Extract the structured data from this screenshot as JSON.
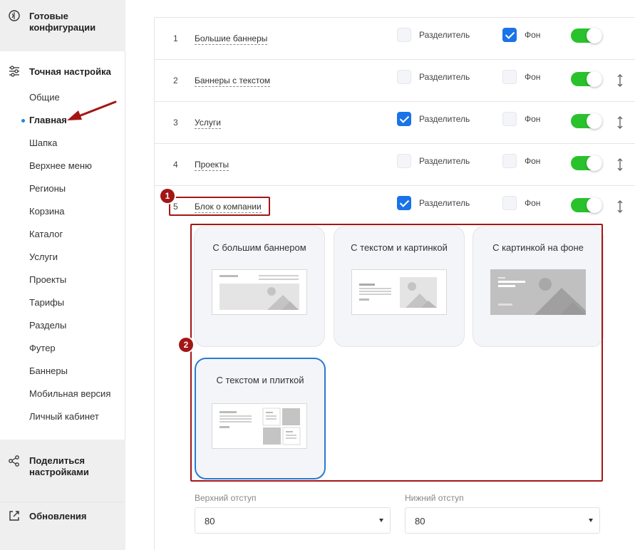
{
  "sidebar": {
    "ready_configs": "Готовые конфигурации",
    "fine_tuning": "Точная настройка",
    "items": [
      {
        "label": "Общие"
      },
      {
        "label": "Главная",
        "active": true
      },
      {
        "label": "Шапка"
      },
      {
        "label": "Верхнее меню"
      },
      {
        "label": "Регионы"
      },
      {
        "label": "Корзина"
      },
      {
        "label": "Каталог"
      },
      {
        "label": "Услуги"
      },
      {
        "label": "Проекты"
      },
      {
        "label": "Тарифы"
      },
      {
        "label": "Разделы"
      },
      {
        "label": "Футер"
      },
      {
        "label": "Баннеры"
      },
      {
        "label": "Мобильная версия"
      },
      {
        "label": "Личный кабинет"
      }
    ],
    "share": "Поделиться настройками",
    "updates": "Обновления"
  },
  "rows": [
    {
      "num": "1",
      "name": "Большие баннеры",
      "divider": false,
      "background": true,
      "enabled": true
    },
    {
      "num": "2",
      "name": "Баннеры с текстом",
      "divider": false,
      "background": false,
      "enabled": true
    },
    {
      "num": "3",
      "name": "Услуги",
      "divider": true,
      "background": false,
      "enabled": true
    },
    {
      "num": "4",
      "name": "Проекты",
      "divider": false,
      "background": false,
      "enabled": true
    },
    {
      "num": "5",
      "name": "Блок о компании",
      "divider": true,
      "background": false,
      "enabled": true
    }
  ],
  "labels": {
    "divider": "Разделитель",
    "background": "Фон"
  },
  "variants": [
    {
      "title": "С большим баннером",
      "selected": false
    },
    {
      "title": "С текстом и картинкой",
      "selected": false
    },
    {
      "title": "С картинкой на фоне",
      "selected": false
    },
    {
      "title": "С текстом и плиткой",
      "selected": true
    }
  ],
  "badges": {
    "one": "1",
    "two": "2"
  },
  "padding": {
    "top_label": "Верхний отступ",
    "top_value": "80",
    "bottom_label": "Нижний отступ",
    "bottom_value": "80"
  },
  "colors": {
    "accent": "#1a73e8",
    "toggle_on": "#29c22c",
    "annotation": "#a31616",
    "selected_border": "#2a7ad1"
  }
}
